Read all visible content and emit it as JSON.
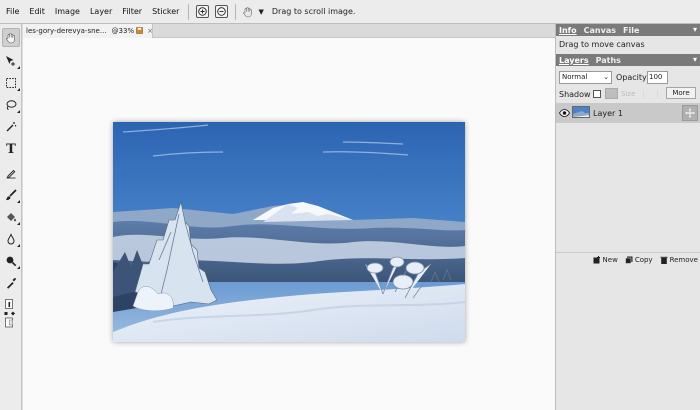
{
  "menubar": {
    "items": [
      "File",
      "Edit",
      "Image",
      "Layer",
      "Filter",
      "Sticker"
    ],
    "hint": "Drag to scroll image."
  },
  "tools": {
    "icons": [
      "hand-icon",
      "move-icon",
      "marquee-icon",
      "lasso-icon",
      "magic-wand-icon",
      "type-icon",
      "pen-icon",
      "brush-icon",
      "fill-icon",
      "blur-icon",
      "zoom-icon",
      "eyedropper-icon",
      "color-swatch-icon"
    ],
    "type_label": "T"
  },
  "document": {
    "tab_name": "les-gory-derevya-sne...",
    "zoom": "@33%",
    "close": "×"
  },
  "right_panel": {
    "tabs": [
      "Info",
      "Canvas",
      "File"
    ],
    "collapse": "▾",
    "info_message": "Drag to move canvas",
    "layers_tabs": [
      "Layers",
      "Paths"
    ],
    "blend_mode": "Normal",
    "opacity_label": "Opacity",
    "opacity_value": "100",
    "shadow_label": "Shadow",
    "size_label": "Size",
    "more_label": "More",
    "layer_name": "Layer 1",
    "actions": {
      "new": "New",
      "copy": "Copy",
      "remove": "Remove"
    }
  },
  "colors": {
    "panel_header": "#7a7a7a",
    "selected_layer": "#c9c9c9",
    "canvas": "#fafafa"
  }
}
